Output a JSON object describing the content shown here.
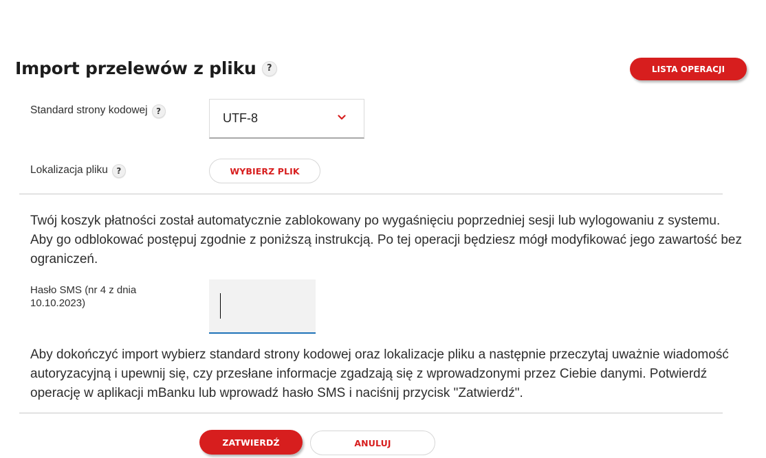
{
  "header": {
    "title": "Import przelewów z pliku",
    "title_help_icon": "?",
    "operations_list_button": "LISTA OPERACJI"
  },
  "form": {
    "codepage": {
      "label": "Standard strony kodowej",
      "help_icon": "?",
      "selected_value": "UTF-8",
      "icon": "chevron-down-icon"
    },
    "file_location": {
      "label": "Lokalizacja pliku",
      "help_icon": "?",
      "choose_file_button": "WYBIERZ PLIK"
    },
    "blocked_basket_message": "Twój koszyk płatności został automatycznie zablokowany po wygaśnięciu poprzedniej sesji lub wylogowaniu z systemu. Aby go odblokować postępuj zgodnie z poniższą instrukcją. Po tej operacji będziesz mógł modyfikować jego zawartość bez ograniczeń.",
    "sms": {
      "label": "Hasło SMS (nr 4 z dnia 10.10.2023)",
      "value": ""
    },
    "instruction_message": "Aby dokończyć import wybierz standard strony kodowej oraz lokalizacje pliku a następnie przeczytaj uważnie wiadomość autoryzacyjną i upewnij się, czy przesłane informacje zgadzają się z wprowadzonymi przez Ciebie danymi. Potwierdź operację w aplikacji mBanku lub wprowadź hasło SMS i naciśnij przycisk \"Zatwierdź\"."
  },
  "actions": {
    "confirm_button": "ZATWIERDŹ",
    "cancel_button": "ANULUJ"
  },
  "colors": {
    "accent": "#d71e1e",
    "input_focus": "#1d72b8"
  }
}
